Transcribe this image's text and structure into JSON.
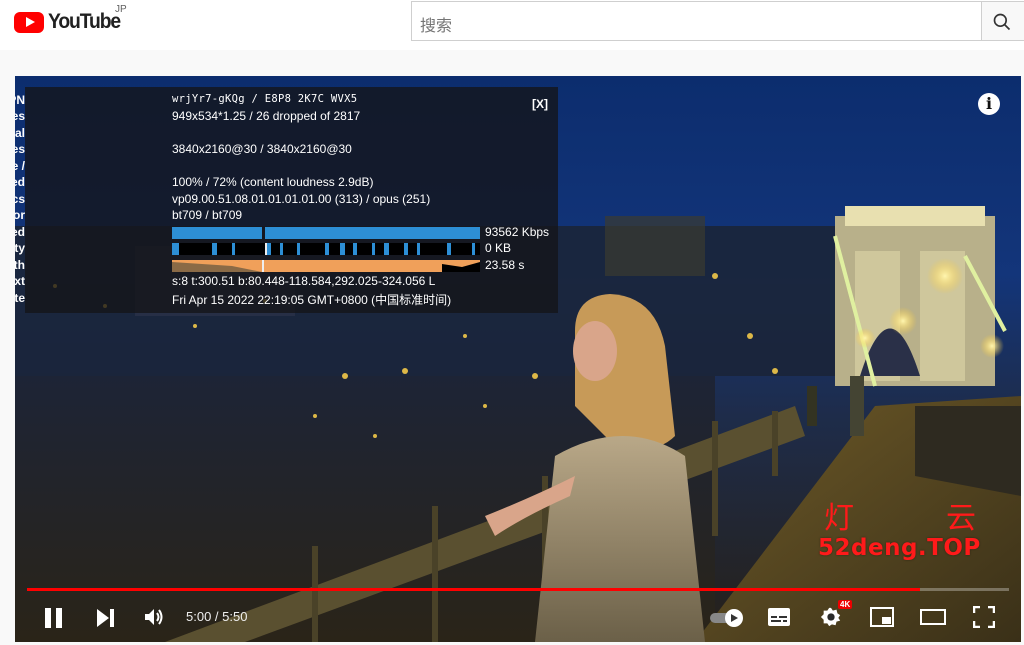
{
  "header": {
    "logo_text": "YouTube",
    "country_code": "JP",
    "search_placeholder": "搜索"
  },
  "player": {
    "info_icon": "i",
    "stats": {
      "close_label": "[X]",
      "rows": [
        {
          "label": "Video ID / sCPN",
          "value": "wrjYr7-gKQg / E8P8 2K7C WVX5"
        },
        {
          "label": "Viewport / Frames",
          "value": "949x534*1.25 / 26 dropped of 2817"
        },
        {
          "label": "Current / Optimal",
          "value": ""
        },
        {
          "label": "Res",
          "value": "3840x2160@30 / 3840x2160@30"
        },
        {
          "label": "Volume /",
          "value": ""
        },
        {
          "label": "Normalized",
          "value": "100% / 72% (content loudness 2.9dB)"
        },
        {
          "label": "Codecs",
          "value": "vp09.00.51.08.01.01.01.01.00 (313) / opus (251)"
        },
        {
          "label": "Color",
          "value": "bt709 / bt709"
        },
        {
          "label": "Connection Speed",
          "value": "93562 Kbps"
        },
        {
          "label": "Network Activity",
          "value": "0 KB"
        },
        {
          "label": "Buffer Health",
          "value": "23.58 s"
        },
        {
          "label": "Mystery Text",
          "value": "s:8 t:300.51 b:80.448-118.584,292.025-324.056 L"
        },
        {
          "label": "Date",
          "value": "Fri Apr 15 2022 22:19:05 GMT+0800 (中国标准时间)"
        }
      ]
    },
    "progress_fraction": 0.9091,
    "time_display": "5:00 / 5:50",
    "quality_badge": "4K",
    "colors": {
      "progress": "#ff0000",
      "stats_bar_blue": "#2d8fd5",
      "stats_bar_orange": "#f0a05a"
    }
  },
  "watermark": {
    "char_left": "灯",
    "char_right": "云",
    "text": "52deng.TOP"
  },
  "icons": [
    "youtube-logo-icon",
    "search-icon",
    "info-icon",
    "pause-icon",
    "next-icon",
    "volume-icon",
    "autoplay-toggle-icon",
    "subtitles-icon",
    "settings-icon",
    "miniplayer-icon",
    "theater-icon",
    "fullscreen-icon"
  ]
}
